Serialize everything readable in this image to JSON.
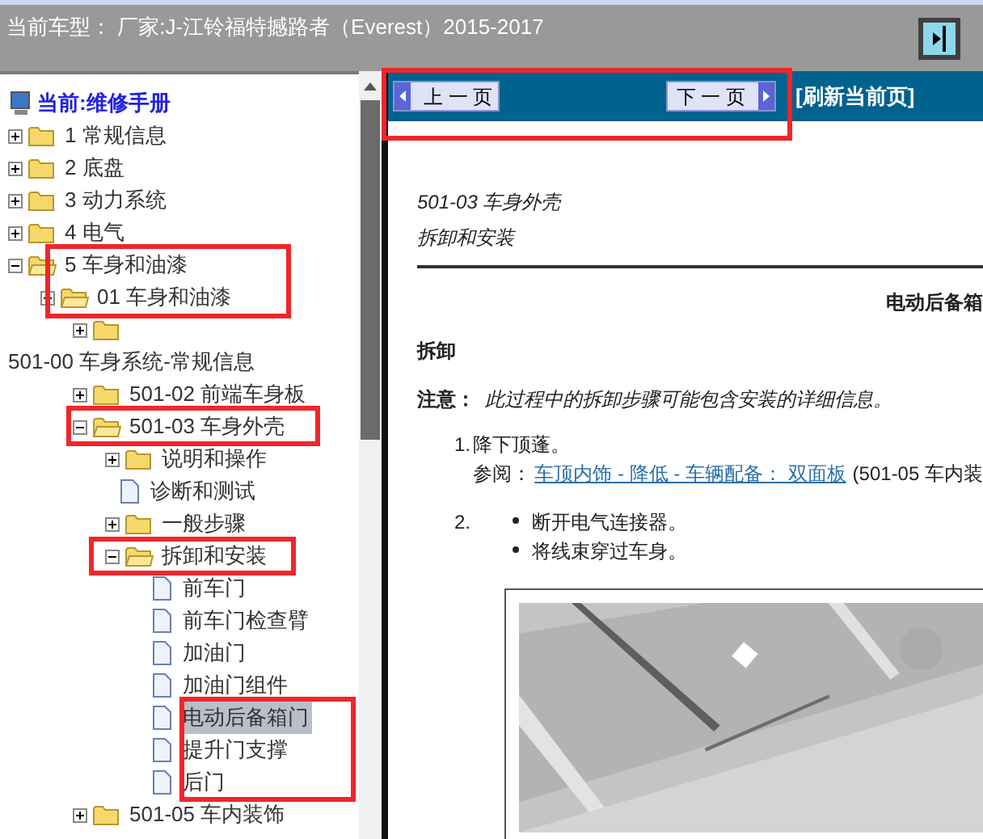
{
  "header": {
    "title": "当前车型： 厂家:J-江铃福特撼路者（Everest）2015-2017"
  },
  "tree": {
    "root": {
      "label": "当前:维修手册"
    },
    "items": [
      {
        "kind": "folder",
        "label": "1 常规信息",
        "expanded": false,
        "selected": false
      },
      {
        "kind": "folder",
        "label": "2 底盘",
        "expanded": false,
        "selected": false
      },
      {
        "kind": "folder",
        "label": "3 动力系统",
        "expanded": false,
        "selected": false
      },
      {
        "kind": "folder",
        "label": "4 电气",
        "expanded": false,
        "selected": false
      },
      {
        "kind": "folder",
        "label": "5 车身和油漆",
        "expanded": true,
        "selected": false,
        "children": [
          {
            "kind": "folder",
            "label": "01 车身和油漆",
            "expanded": true,
            "selected": false,
            "children": [
              {
                "kind": "folder",
                "expanded": false,
                "selected": false
              },
              {
                "kind": "label",
                "label": "501-00 车身系统-常规信息",
                "selected": false
              },
              {
                "kind": "folder",
                "label": "501-02 前端车身板",
                "expanded": false,
                "selected": false
              },
              {
                "kind": "folder",
                "label": "501-03 车身外壳",
                "expanded": true,
                "selected": false,
                "children": [
                  {
                    "kind": "folder",
                    "label": "说明和操作",
                    "expanded": false,
                    "selected": false
                  },
                  {
                    "kind": "document",
                    "label": "诊断和测试",
                    "selected": false
                  },
                  {
                    "kind": "folder",
                    "label": "一般步骤",
                    "expanded": false,
                    "selected": false
                  },
                  {
                    "kind": "folder",
                    "label": "拆卸和安装",
                    "expanded": true,
                    "selected": false,
                    "children": [
                      {
                        "kind": "document",
                        "label": "前车门",
                        "selected": false
                      },
                      {
                        "kind": "document",
                        "label": "前车门检查臂",
                        "selected": false
                      },
                      {
                        "kind": "document",
                        "label": "加油门",
                        "selected": false
                      },
                      {
                        "kind": "document",
                        "label": "加油门组件",
                        "selected": false
                      },
                      {
                        "kind": "document",
                        "label": "电动后备箱门",
                        "selected": true
                      },
                      {
                        "kind": "document",
                        "label": "提升门支撑",
                        "selected": false
                      },
                      {
                        "kind": "document",
                        "label": "后门",
                        "selected": false
                      }
                    ]
                  }
                ]
              },
              {
                "kind": "folder",
                "label": "501-05 车内装饰",
                "expanded": false,
                "selected": false
              }
            ]
          }
        ]
      }
    ]
  },
  "nav": {
    "prev": "上 一 页",
    "next": "下 一 页",
    "refresh": "[刷新当前页]"
  },
  "document": {
    "section": "501-03 车身外壳",
    "subtitle": "拆卸和安装",
    "heading": "电动后备箱",
    "removal": "拆卸",
    "note_label": "注意：",
    "note": "此过程中的拆卸步骤可能包含安装的详细信息。",
    "steps": [
      {
        "number": "1.",
        "text": "降下顶蓬。",
        "ref_label": "参阅：",
        "ref_link": "车顶内饰 - 降低 - 车辆配备： 双面板",
        "ref_tail": "(501-05 车内装"
      },
      {
        "number": "2.",
        "bullets": [
          "断开电气连接器。",
          "将线束穿过车身。"
        ]
      }
    ]
  }
}
